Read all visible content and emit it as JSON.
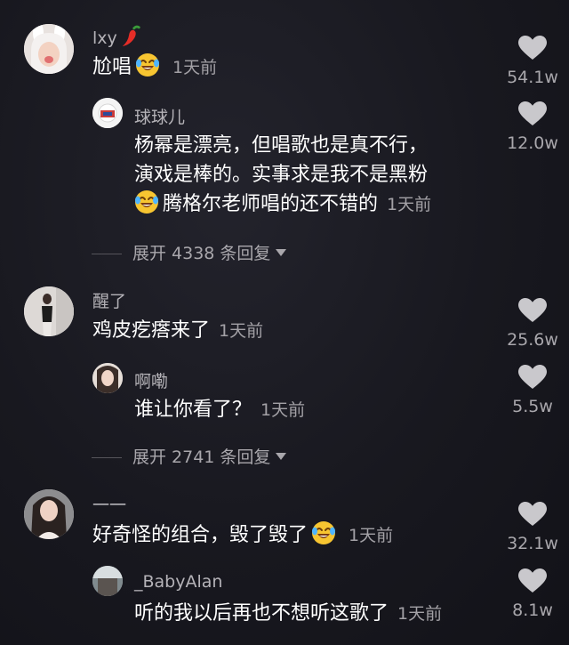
{
  "comments": [
    {
      "user": "lxy",
      "text": "尬唱",
      "time": "1天前",
      "likes": "54.1w",
      "reply": {
        "user": "球球儿",
        "lines": [
          "杨幂是漂亮，但唱歌也是真不行，",
          "演戏是棒的。实事求是我不是黑粉",
          "腾格尔老师唱的还不错的"
        ],
        "time": "1天前",
        "likes": "12.0w"
      },
      "expand": "展开 4338 条回复"
    },
    {
      "user": "醒了",
      "text": "鸡皮疙瘩来了",
      "time": "1天前",
      "likes": "25.6w",
      "reply": {
        "user": "啊嘞",
        "text": "谁让你看了？",
        "time": "1天前",
        "likes": "5.5w"
      },
      "expand": "展开 2741 条回复"
    },
    {
      "user": "一一",
      "text": "好奇怪的组合，毁了毁了",
      "time": "1天前",
      "likes": "32.1w",
      "reply": {
        "user": "_BabyAlan",
        "text": "听的我以后再也不想听这歌了",
        "time": "1天前",
        "likes": "8.1w"
      }
    }
  ],
  "icons": {
    "like": "heart-icon",
    "emoji": "laughing-crying-emoji",
    "chili": "chili-pepper-emoji"
  },
  "colors": {
    "background": "#18181f",
    "username": "#b5b3b8",
    "secondary": "#a3a1a6",
    "heart": "#c9c8cc"
  }
}
